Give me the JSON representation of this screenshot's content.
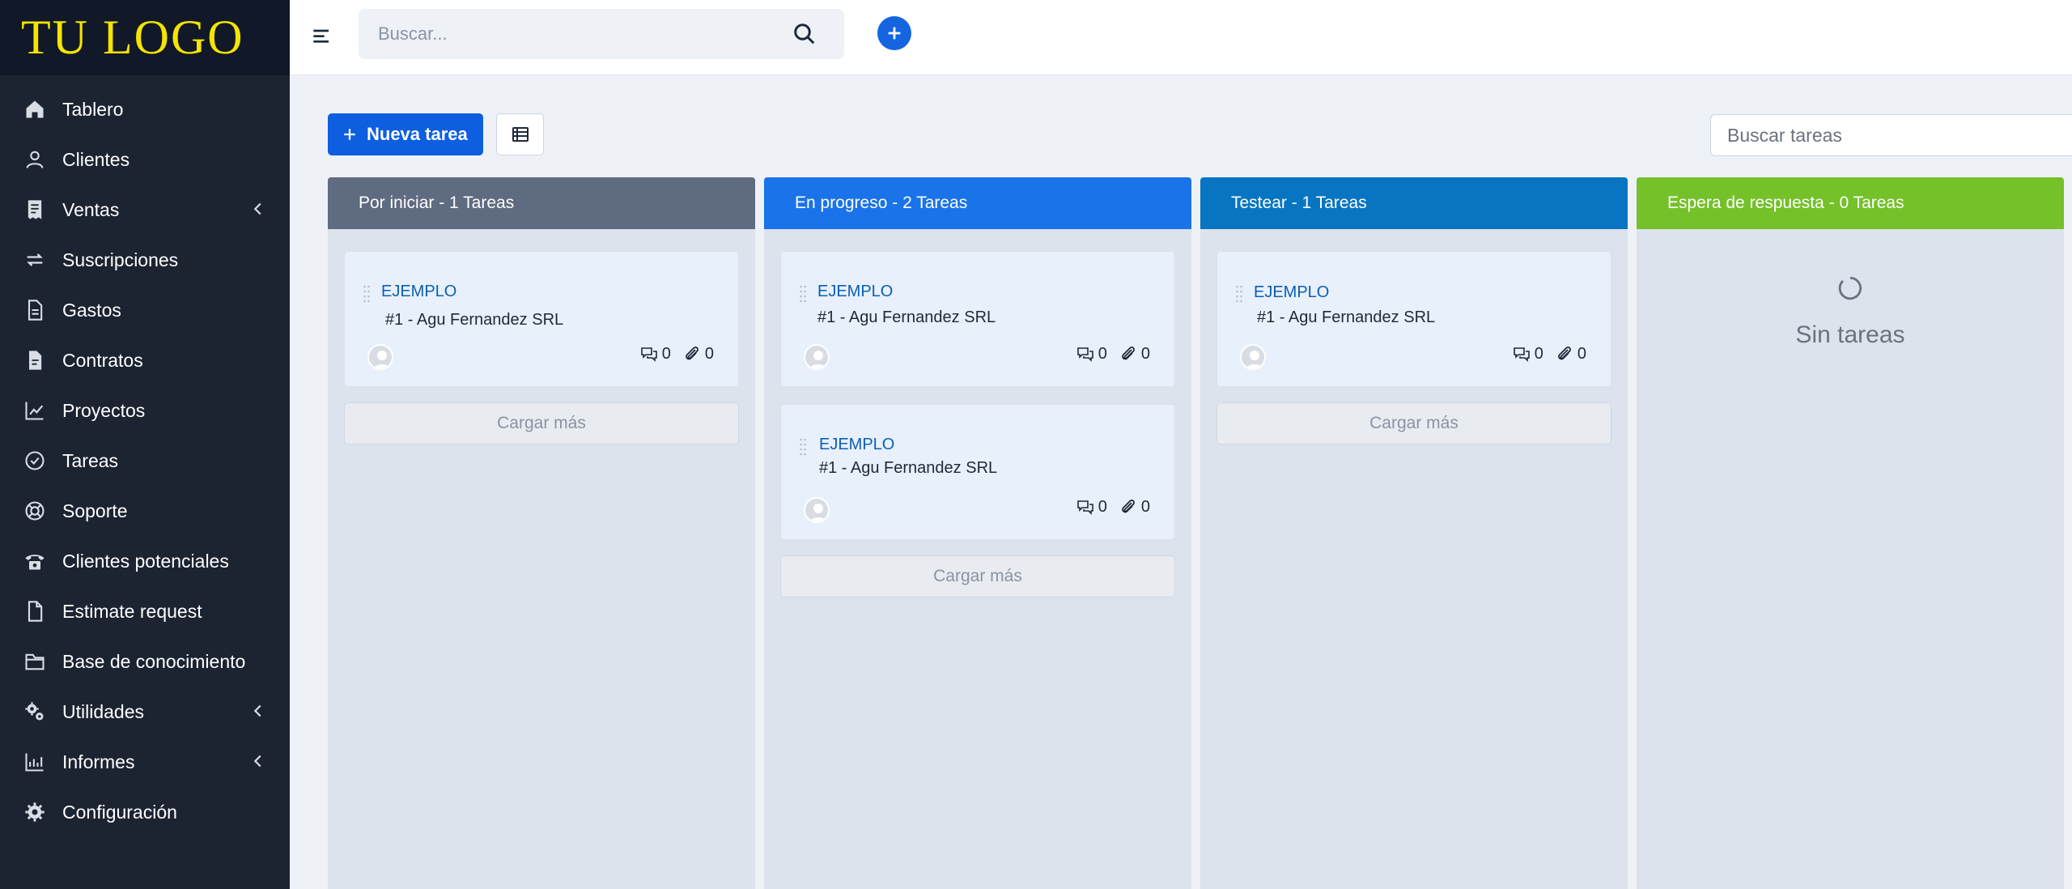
{
  "sidebar": {
    "logo": "TU LOGO",
    "items": [
      {
        "label": "Tablero",
        "icon": "home-icon"
      },
      {
        "label": "Clientes",
        "icon": "user-icon"
      },
      {
        "label": "Ventas",
        "icon": "receipt-icon",
        "expandable": true
      },
      {
        "label": "Suscripciones",
        "icon": "refresh-icon"
      },
      {
        "label": "Gastos",
        "icon": "document-icon"
      },
      {
        "label": "Contratos",
        "icon": "contract-icon"
      },
      {
        "label": "Proyectos",
        "icon": "chart-icon"
      },
      {
        "label": "Tareas",
        "icon": "check-circle-icon"
      },
      {
        "label": "Soporte",
        "icon": "lifebuoy-icon"
      },
      {
        "label": "Clientes potenciales",
        "icon": "phone-icon"
      },
      {
        "label": "Estimate request",
        "icon": "file-icon"
      },
      {
        "label": "Base de conocimiento",
        "icon": "folder-icon"
      },
      {
        "label": "Utilidades",
        "icon": "cogs-icon",
        "expandable": true
      },
      {
        "label": "Informes",
        "icon": "bar-chart-icon",
        "expandable": true
      },
      {
        "label": "Configuración",
        "icon": "gear-icon"
      }
    ]
  },
  "header": {
    "search_placeholder": "Buscar..."
  },
  "toolbar": {
    "new_task_label": "Nueva tarea",
    "task_search_placeholder": "Buscar tareas"
  },
  "columns": [
    {
      "title": "Por iniciar - 1 Tareas",
      "color": "#5f6b80",
      "cards": [
        {
          "title": "EJEMPLO",
          "client": "#1 -  Agu Fernandez SRL",
          "comments": "0",
          "attachments": "0"
        }
      ],
      "load_more": "Cargar más"
    },
    {
      "title": "En progreso - 2 Tareas",
      "color": "#1a73e8",
      "cards": [
        {
          "title": "EJEMPLO",
          "client": "#1 -  Agu Fernandez SRL",
          "comments": "0",
          "attachments": "0"
        },
        {
          "title": "EJEMPLO",
          "client": "#1 -  Agu Fernandez SRL",
          "comments": "0",
          "attachments": "0"
        }
      ],
      "load_more": "Cargar más"
    },
    {
      "title": "Testear - 1 Tareas",
      "color": "#0875c2",
      "cards": [
        {
          "title": "EJEMPLO",
          "client": "#1 -  Agu Fernandez SRL",
          "comments": "0",
          "attachments": "0"
        }
      ],
      "load_more": "Cargar más"
    },
    {
      "title": "Espera de respuesta - 0 Tareas",
      "color": "#74c12a",
      "cards": [],
      "empty_text": "Sin tareas"
    }
  ],
  "colors": {
    "sidebar_bg": "#1c2331",
    "logo": "#f5e400",
    "primary": "#0d5fe0"
  }
}
